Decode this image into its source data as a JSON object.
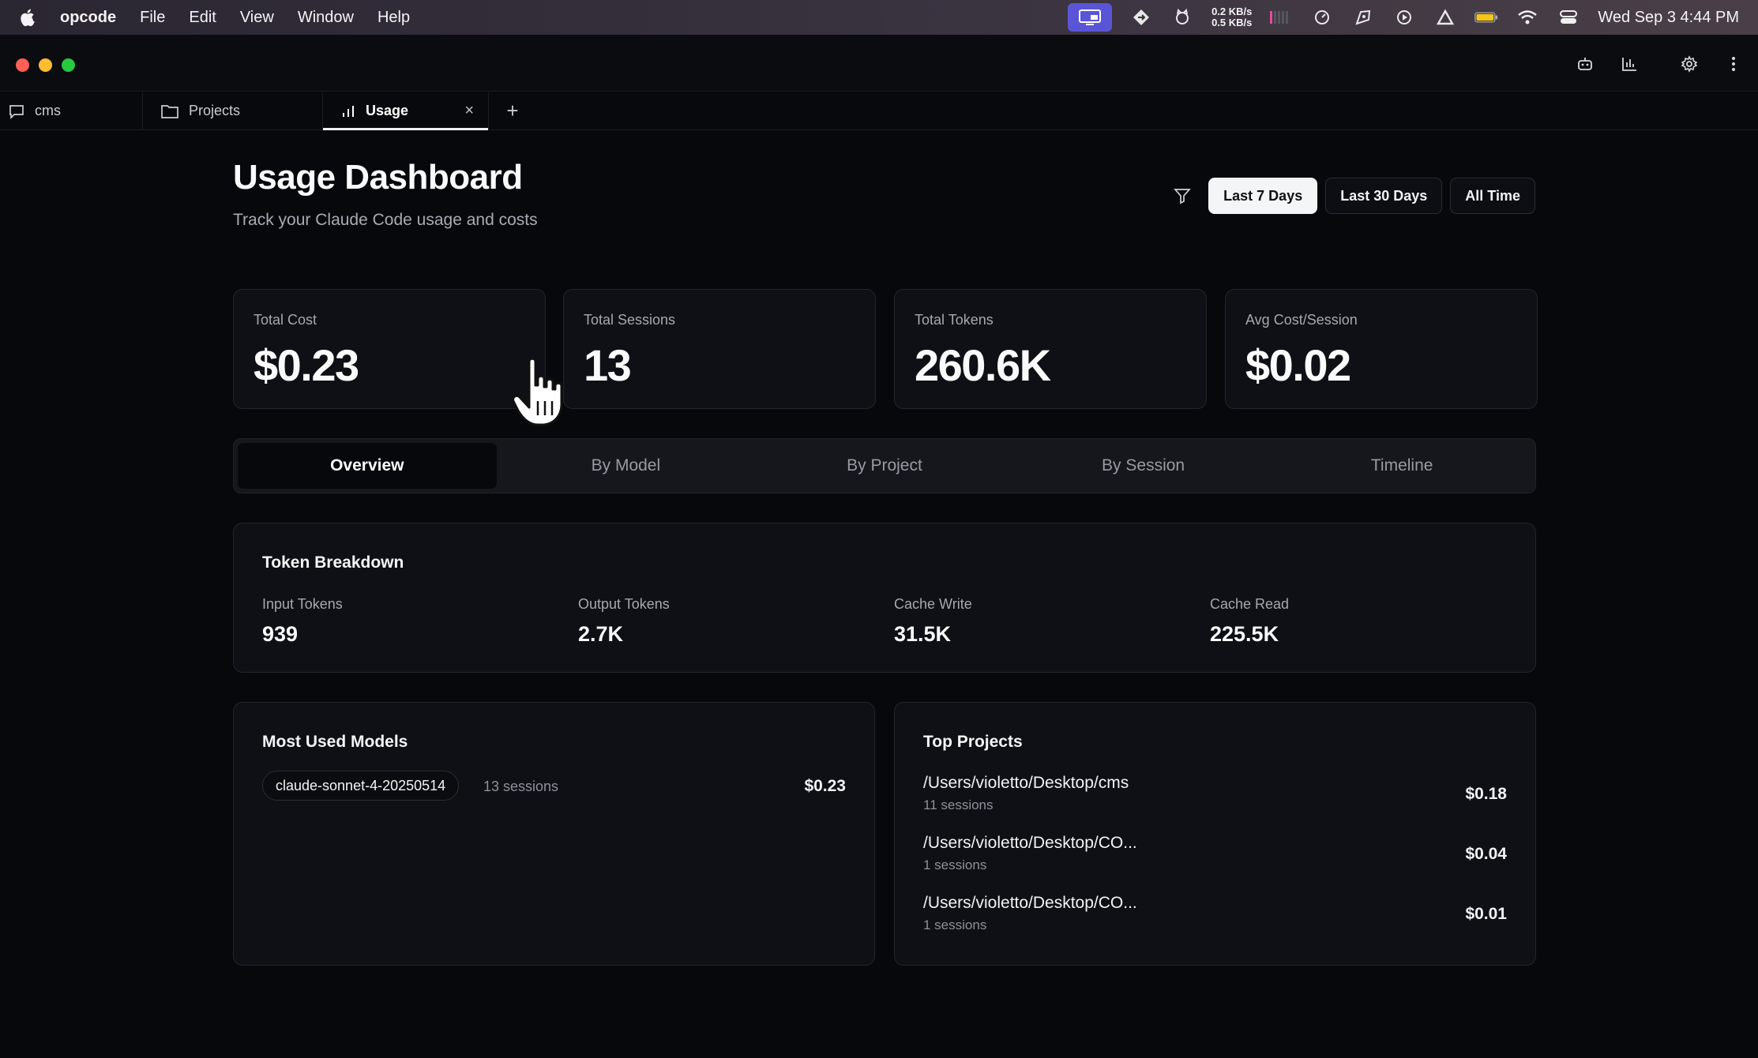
{
  "menubar": {
    "app_name": "opcode",
    "menus": [
      "File",
      "Edit",
      "View",
      "Window",
      "Help"
    ],
    "net_up": "0.2 KB/s",
    "net_down": "0.5 KB/s",
    "clock": "Wed Sep 3  4:44 PM"
  },
  "tabs": [
    {
      "label": "cms",
      "icon": "chat-icon"
    },
    {
      "label": "Projects",
      "icon": "folder-icon"
    },
    {
      "label": "Usage",
      "icon": "bar-chart-icon",
      "active": true,
      "close": "×"
    }
  ],
  "tab_add": "+",
  "header": {
    "title": "Usage Dashboard",
    "subtitle": "Track your Claude Code usage and costs"
  },
  "range": {
    "options": [
      "Last 7 Days",
      "Last 30 Days",
      "All Time"
    ],
    "selected": "Last 7 Days"
  },
  "stats": [
    {
      "label": "Total Cost",
      "value": "$0.23"
    },
    {
      "label": "Total Sessions",
      "value": "13"
    },
    {
      "label": "Total Tokens",
      "value": "260.6K"
    },
    {
      "label": "Avg Cost/Session",
      "value": "$0.02"
    }
  ],
  "view_tabs": {
    "items": [
      "Overview",
      "By Model",
      "By Project",
      "By Session",
      "Timeline"
    ],
    "selected": "Overview"
  },
  "token_breakdown": {
    "title": "Token Breakdown",
    "items": [
      {
        "label": "Input Tokens",
        "value": "939"
      },
      {
        "label": "Output Tokens",
        "value": "2.7K"
      },
      {
        "label": "Cache Write",
        "value": "31.5K"
      },
      {
        "label": "Cache Read",
        "value": "225.5K"
      }
    ]
  },
  "most_used_models": {
    "title": "Most Used Models",
    "items": [
      {
        "model": "claude-sonnet-4-20250514",
        "sessions": "13 sessions",
        "cost": "$0.23"
      }
    ]
  },
  "top_projects": {
    "title": "Top Projects",
    "items": [
      {
        "path": "/Users/violetto/Desktop/cms",
        "sessions": "11 sessions",
        "cost": "$0.18"
      },
      {
        "path": "/Users/violetto/Desktop/CO...",
        "sessions": "1 sessions",
        "cost": "$0.04"
      },
      {
        "path": "/Users/violetto/Desktop/CO...",
        "sessions": "1 sessions",
        "cost": "$0.01"
      }
    ]
  },
  "colors": {
    "background": "#07080c",
    "card": "#0e1015",
    "border": "#22252c",
    "text": "#f2f3f5",
    "muted": "#a5a8b0",
    "active_button": "#f4f5f7",
    "traffic_red": "#ff5f57",
    "traffic_yellow": "#febc2e",
    "traffic_green": "#28c840"
  }
}
